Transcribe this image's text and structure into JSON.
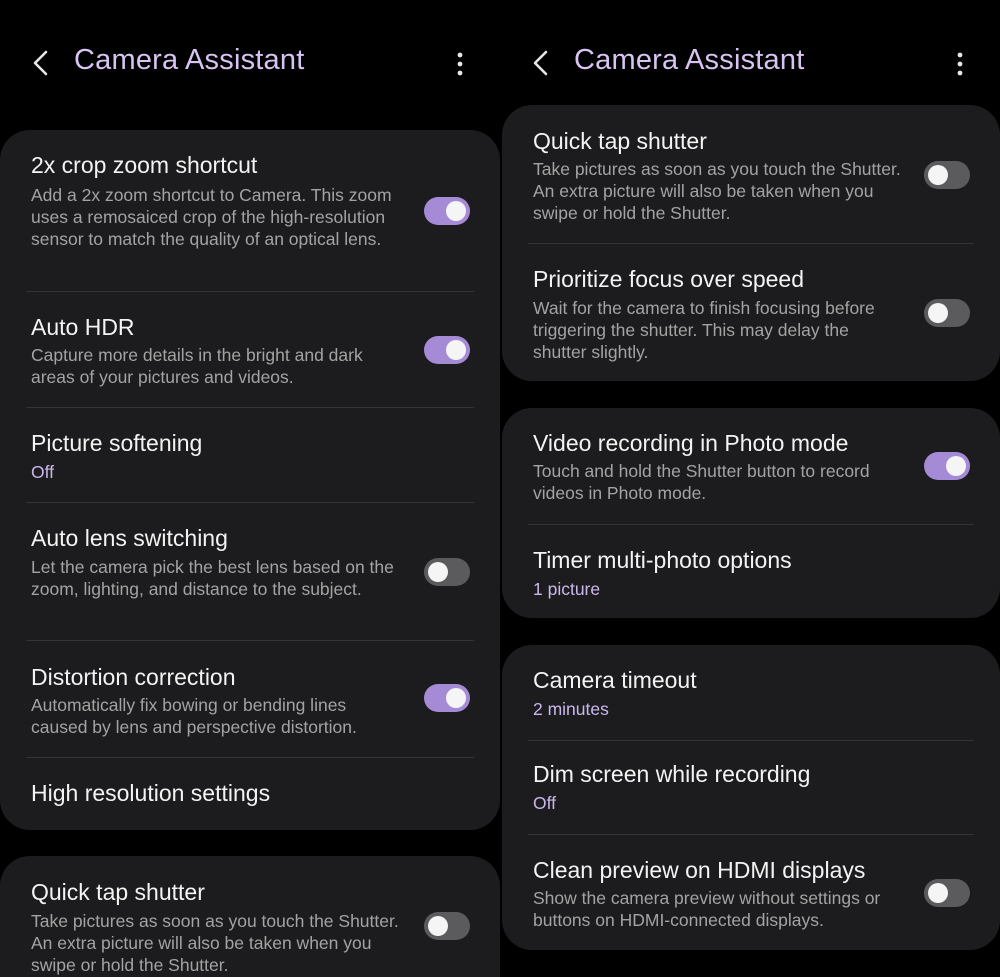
{
  "colors": {
    "accent": "#a58ad6",
    "title": "#d8c4f2",
    "value": "#cbb7ec",
    "card": "#1c1c1e",
    "background": "#000000"
  },
  "left": {
    "header": {
      "title": "Camera Assistant",
      "back_icon": "chevron-left-icon",
      "more_icon": "more-vertical-icon"
    },
    "items": [
      {
        "title": "2x crop zoom shortcut",
        "desc": "Add a 2x zoom shortcut to Camera. This zoom uses a remosaiced crop of the high-resolution sensor to match the quality of an optical lens.",
        "toggle": "on"
      },
      {
        "title": "Auto HDR",
        "desc": "Capture more details in the bright and dark areas of your pictures and videos.",
        "toggle": "on"
      },
      {
        "title": "Picture softening",
        "value": "Off"
      },
      {
        "title": "Auto lens switching",
        "desc": "Let the camera pick the best lens based on the zoom, lighting, and distance to the subject.",
        "toggle": "off"
      },
      {
        "title": "Distortion correction",
        "desc": "Automatically fix bowing or bending lines caused by lens and perspective distortion.",
        "toggle": "on"
      },
      {
        "title": "High resolution settings"
      },
      {
        "title": "Quick tap shutter",
        "desc": "Take pictures as soon as you touch the Shutter. An extra picture will also be taken when you swipe or hold the Shutter.",
        "toggle": "off"
      }
    ]
  },
  "right": {
    "header": {
      "title": "Camera Assistant",
      "back_icon": "chevron-left-icon",
      "more_icon": "more-vertical-icon"
    },
    "items": [
      {
        "title": "Quick tap shutter",
        "desc": "Take pictures as soon as you touch the Shutter. An extra picture will also be taken when you swipe or hold the Shutter.",
        "toggle": "off"
      },
      {
        "title": "Prioritize focus over speed",
        "desc": "Wait for the camera to finish focusing before triggering the shutter. This may delay the shutter slightly.",
        "toggle": "off"
      },
      {
        "title": "Video recording in Photo mode",
        "desc": "Touch and hold the Shutter button to record videos in Photo mode.",
        "toggle": "on"
      },
      {
        "title": "Timer multi-photo options",
        "value": "1 picture"
      },
      {
        "title": "Camera timeout",
        "value": "2 minutes"
      },
      {
        "title": "Dim screen while recording",
        "value": "Off"
      },
      {
        "title": "Clean preview on HDMI displays",
        "desc": "Show the camera preview without settings or buttons on HDMI-connected displays.",
        "toggle": "off"
      }
    ]
  }
}
